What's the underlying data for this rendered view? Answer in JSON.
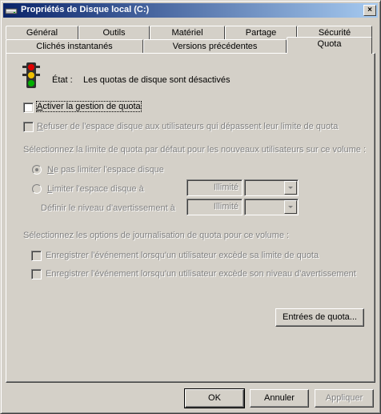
{
  "window": {
    "title": "Propriétés de Disque local (C:)",
    "close_glyph": "×"
  },
  "tabs_back": [
    "Général",
    "Outils",
    "Matériel",
    "Partage",
    "Sécurité"
  ],
  "tabs_front": [
    "Clichés instantanés",
    "Versions précédentes",
    "Quota"
  ],
  "status": {
    "label": "État :",
    "value": "Les quotas de disque sont désactivés"
  },
  "enable_quota": {
    "mnemonic": "A",
    "rest": "ctiver la gestion de quota",
    "checked": false
  },
  "deny_space": {
    "mnemonic": "R",
    "rest": "efuser de l'espace disque aux utilisateurs qui dépassent leur limite de quota",
    "checked": false
  },
  "default_limit_heading": "Sélectionnez la limite de quota par défaut pour les nouveaux utilisateurs sur ce volume :",
  "no_limit": {
    "mnemonic": "N",
    "rest": "e pas limiter l'espace disque",
    "selected": true
  },
  "limit": {
    "mnemonic": "L",
    "rest": "imiter l'espace disque à",
    "value": "Illimité",
    "selected": false
  },
  "warning": {
    "label": "Définir le niveau d'avertissement à",
    "value": "Illimité"
  },
  "logging_heading": "Sélectionnez les options de journalisation de quota pour ce volume :",
  "log_limit": {
    "label": "Enregistrer l'événement lorsqu'un utilisateur excède sa limite de quota",
    "checked": false
  },
  "log_warning": {
    "label": "Enregistrer l'événement lorsqu'un utilisateur excède son niveau d'avertissement",
    "checked": false
  },
  "entries_button": "Entrées de quota...",
  "footer": {
    "ok": "OK",
    "cancel": "Annuler",
    "apply": "Appliquer"
  },
  "colors": {
    "face": "#d4d0c8",
    "title_start": "#0a246a",
    "title_end": "#a6caf0",
    "disabled_text": "#808080"
  }
}
